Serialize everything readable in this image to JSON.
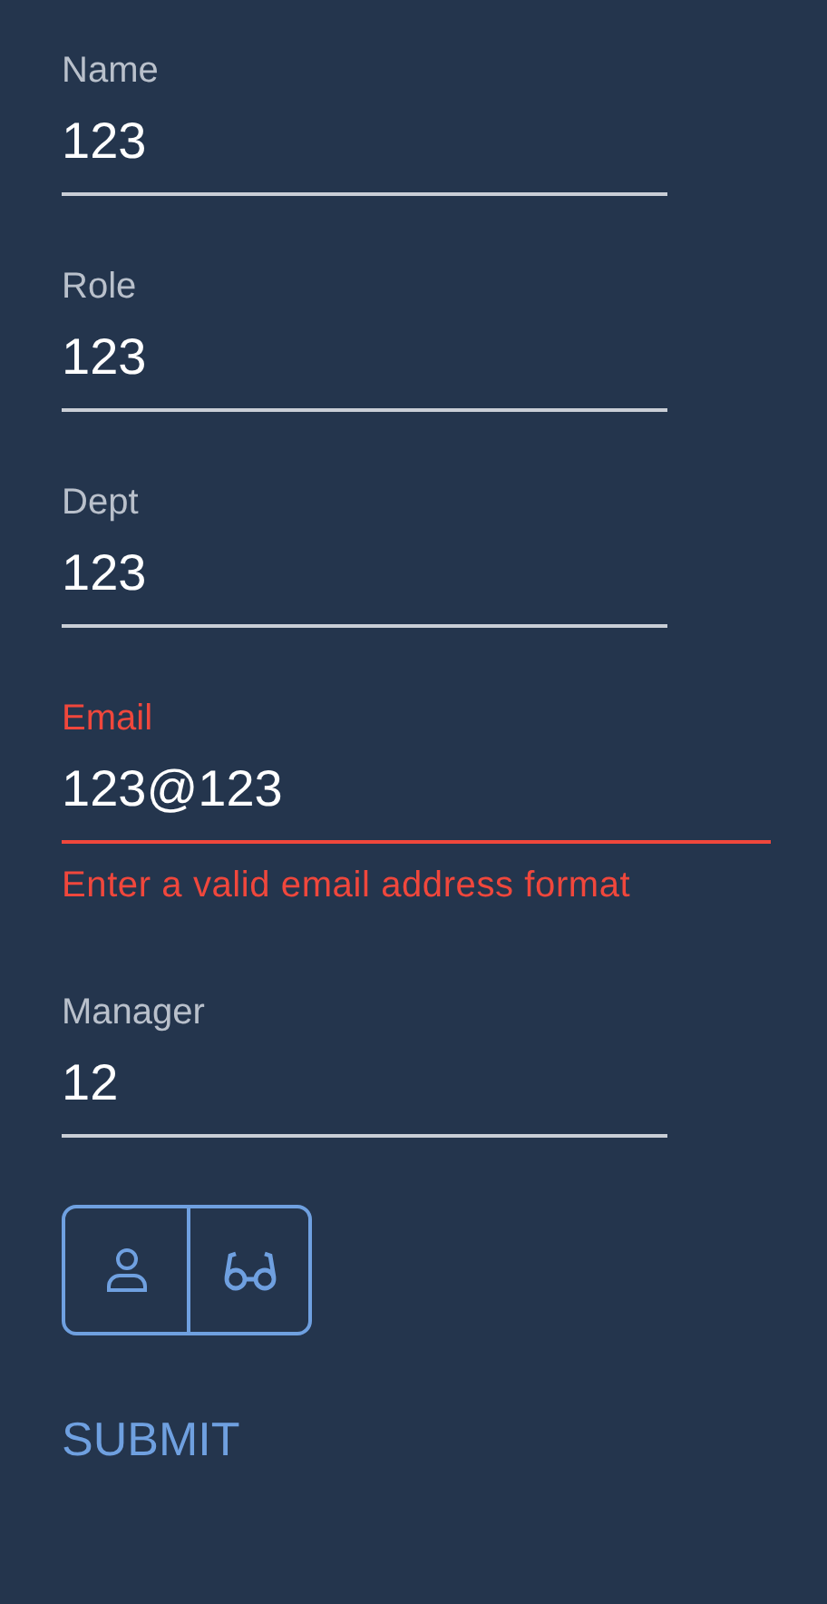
{
  "fields": [
    {
      "label": "Name",
      "value": "123",
      "invalid": false
    },
    {
      "label": "Role",
      "value": "123",
      "invalid": false
    },
    {
      "label": "Dept",
      "value": "123",
      "invalid": false
    },
    {
      "label": "Email",
      "value": "123@123",
      "invalid": true,
      "error": "Enter a valid email address format"
    },
    {
      "label": "Manager",
      "value": "12",
      "invalid": false
    }
  ],
  "toggles": [
    {
      "kind": "person",
      "selected": false
    },
    {
      "kind": "glasses",
      "selected": false
    }
  ],
  "submit": "SUBMIT"
}
